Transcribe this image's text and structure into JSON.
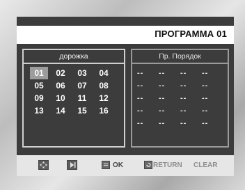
{
  "header": {
    "title": "ПРОГРАММА 01"
  },
  "left_panel": {
    "heading": "дорожка",
    "tracks": [
      "01",
      "02",
      "03",
      "04",
      "05",
      "06",
      "07",
      "08",
      "09",
      "10",
      "11",
      "12",
      "13",
      "14",
      "15",
      "16"
    ],
    "selected_index": 0
  },
  "right_panel": {
    "heading": "Пр. Порядок",
    "slots": [
      "--",
      "--",
      "--",
      "--",
      "--",
      "--",
      "--",
      "--",
      "--",
      "--",
      "--",
      "--",
      "--",
      "--",
      "--",
      "--",
      "--",
      "--",
      "--",
      "--"
    ]
  },
  "footer": {
    "ok_label": "OK",
    "return_label": "RETURN",
    "clear_label": "CLEAR",
    "icons": [
      "navigate-icon",
      "play-icon",
      "enter-icon",
      "return-icon"
    ]
  },
  "colors": {
    "screen_bg": "#3c3c3c",
    "selected_bg": "#9c9c9c",
    "footer_bg": "#e6e6e6"
  }
}
